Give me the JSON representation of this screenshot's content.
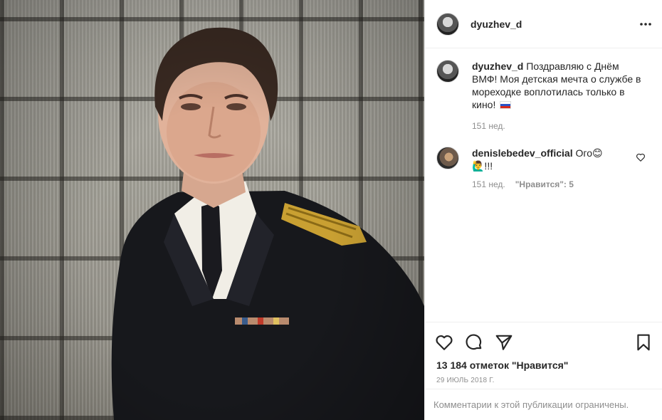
{
  "post": {
    "author": "dyuzhev_d",
    "photo_description_icon": "portrait-photo"
  },
  "caption": {
    "author": "dyuzhev_d",
    "text": "Поздравляю с Днём ВМФ! Моя детская мечта о службе в мореходке воплотилась только в кино!",
    "flag": "🇷🇺",
    "age": "151 нед."
  },
  "comment": {
    "author": "denislebedev_official",
    "text": "Ого😊",
    "emoji_line": "🙋‍♂️!!!",
    "age": "151 нед.",
    "likes": "\"Нравится\": 5"
  },
  "actions": {
    "likes_count": "13 184 отметок \"Нравится\"",
    "date": "29 ИЮЛЬ 2018 Г."
  },
  "footer": {
    "comments_disabled": "Комментарии к этой публикации ограничены."
  },
  "colors": {
    "text": "#262626",
    "muted": "#8e8e8e",
    "border": "#efefef"
  }
}
